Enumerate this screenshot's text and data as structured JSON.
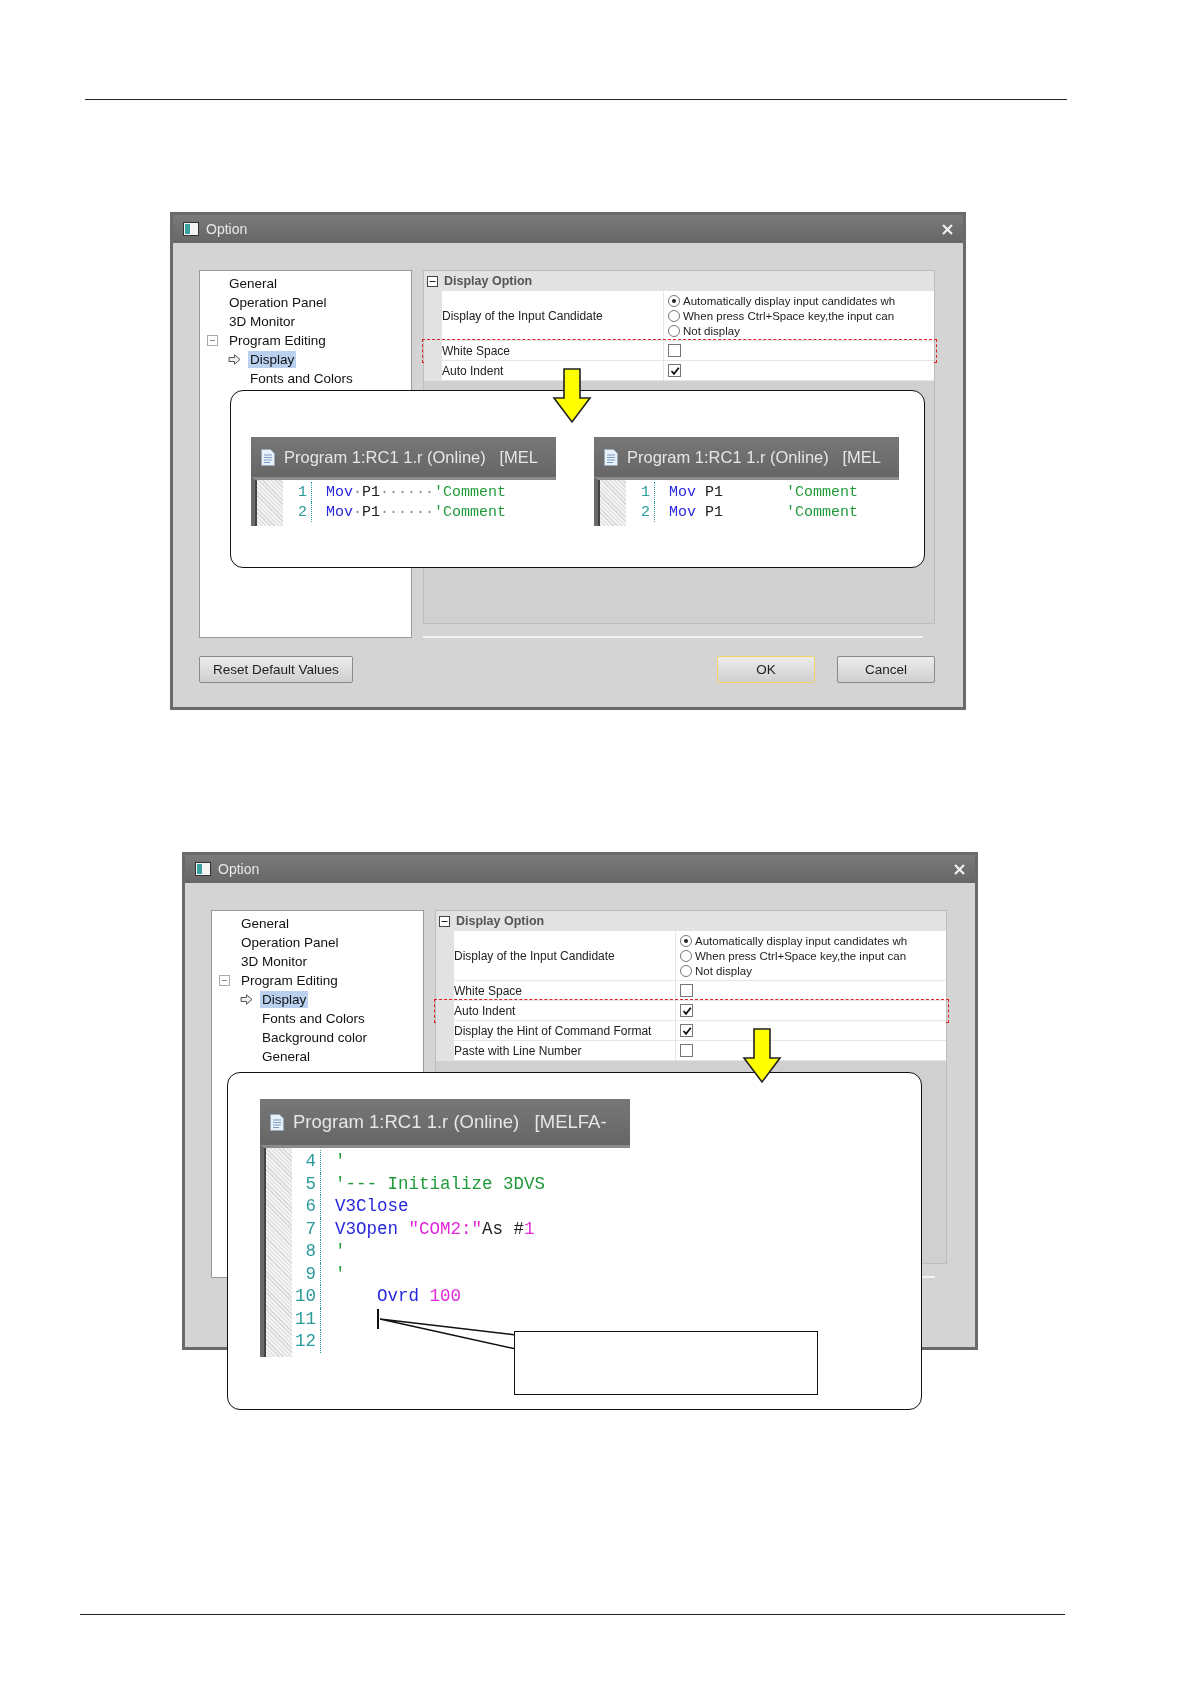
{
  "figures": [
    {
      "dialog": {
        "title": "Option",
        "tree": [
          {
            "label": "General",
            "selected": false
          },
          {
            "label": "Operation Panel",
            "selected": false
          },
          {
            "label": "3D Monitor",
            "selected": false
          },
          {
            "label": "Program Editing",
            "selected": false,
            "expanded": true,
            "children": [
              {
                "label": "Display",
                "selected": true
              },
              {
                "label": "Fonts and Colors",
                "selected": false
              }
            ]
          }
        ],
        "options": {
          "section": "Display Option",
          "expanded": true,
          "rows": [
            {
              "label": "Display of the Input Candidate",
              "kind": "radio",
              "highlighted": false,
              "options": [
                {
                  "label": "Automatically display input candidates wh",
                  "selected": true
                },
                {
                  "label": "When press Ctrl+Space key,the input can",
                  "selected": false
                },
                {
                  "label": "Not display",
                  "selected": false
                }
              ]
            },
            {
              "label": "White Space",
              "kind": "checkbox",
              "checked": false,
              "highlighted": true
            },
            {
              "label": "Auto Indent",
              "kind": "checkbox",
              "checked": true,
              "highlighted": false
            }
          ]
        },
        "buttons": [
          {
            "label": "Reset Default Values",
            "default": false
          },
          {
            "label": "OK",
            "default": true
          },
          {
            "label": "Cancel",
            "default": false
          }
        ]
      },
      "callout": {
        "editors": [
          {
            "title": "Program 1:RC1 1.r (Online)   [MEL",
            "lines": [
              {
                "number": "1",
                "tokens": [
                  {
                    "kind": "keyword",
                    "text": "Mov"
                  },
                  {
                    "kind": "space_mark",
                    "text": "·"
                  },
                  {
                    "kind": "plain",
                    "text": "P1"
                  },
                  {
                    "kind": "space_mark",
                    "text": "······"
                  },
                  {
                    "kind": "comment",
                    "text": "'Comment"
                  }
                ]
              },
              {
                "number": "2",
                "tokens": [
                  {
                    "kind": "keyword",
                    "text": "Mov"
                  },
                  {
                    "kind": "space_mark",
                    "text": "·"
                  },
                  {
                    "kind": "plain",
                    "text": "P1"
                  },
                  {
                    "kind": "space_mark",
                    "text": "······"
                  },
                  {
                    "kind": "comment",
                    "text": "'Comment"
                  }
                ]
              }
            ]
          },
          {
            "title": "Program 1:RC1 1.r (Online)   [MEL",
            "lines": [
              {
                "number": "1",
                "tokens": [
                  {
                    "kind": "keyword",
                    "text": "Mov"
                  },
                  {
                    "kind": "plain",
                    "text": " P1       "
                  },
                  {
                    "kind": "comment",
                    "text": "'Comment"
                  }
                ]
              },
              {
                "number": "2",
                "tokens": [
                  {
                    "kind": "keyword",
                    "text": "Mov"
                  },
                  {
                    "kind": "plain",
                    "text": " P1       "
                  },
                  {
                    "kind": "comment",
                    "text": "'Comment"
                  }
                ]
              }
            ]
          }
        ]
      }
    },
    {
      "dialog": {
        "title": "Option",
        "tree": [
          {
            "label": "General",
            "selected": false
          },
          {
            "label": "Operation Panel",
            "selected": false
          },
          {
            "label": "3D Monitor",
            "selected": false
          },
          {
            "label": "Program Editing",
            "selected": false,
            "expanded": true,
            "children": [
              {
                "label": "Display",
                "selected": true
              },
              {
                "label": "Fonts and Colors",
                "selected": false
              },
              {
                "label": "Background color",
                "selected": false
              },
              {
                "label": "General",
                "selected": false
              }
            ]
          }
        ],
        "options": {
          "section": "Display Option",
          "expanded": true,
          "rows": [
            {
              "label": "Display of the Input Candidate",
              "kind": "radio",
              "highlighted": false,
              "options": [
                {
                  "label": "Automatically display input candidates wh",
                  "selected": true
                },
                {
                  "label": "When press Ctrl+Space key,the input can",
                  "selected": false
                },
                {
                  "label": "Not display",
                  "selected": false
                }
              ]
            },
            {
              "label": "White Space",
              "kind": "checkbox",
              "checked": false,
              "highlighted": false
            },
            {
              "label": "Auto Indent",
              "kind": "checkbox",
              "checked": true,
              "highlighted": true
            },
            {
              "label": "Display the Hint of Command Format",
              "kind": "checkbox",
              "checked": true,
              "highlighted": false
            },
            {
              "label": "Paste with Line Number",
              "kind": "checkbox",
              "checked": false,
              "highlighted": false
            }
          ]
        }
      },
      "callout": {
        "note_box": true,
        "editors": [
          {
            "title": "Program 1:RC1 1.r (Online)   [MELFA-",
            "lines": [
              {
                "number": "4",
                "tokens": [
                  {
                    "kind": "comment",
                    "text": "'"
                  }
                ]
              },
              {
                "number": "5",
                "tokens": [
                  {
                    "kind": "comment",
                    "text": "'--- Initialize 3DVS"
                  }
                ]
              },
              {
                "number": "6",
                "tokens": [
                  {
                    "kind": "keyword",
                    "text": "V3Close"
                  }
                ]
              },
              {
                "number": "7",
                "tokens": [
                  {
                    "kind": "keyword",
                    "text": "V3Open"
                  },
                  {
                    "kind": "string",
                    "text": " \"COM2:\""
                  },
                  {
                    "kind": "plain",
                    "text": "As #"
                  },
                  {
                    "kind": "number",
                    "text": "1"
                  }
                ]
              },
              {
                "number": "8",
                "tokens": [
                  {
                    "kind": "comment",
                    "text": "'"
                  }
                ]
              },
              {
                "number": "9",
                "tokens": [
                  {
                    "kind": "comment",
                    "text": "'"
                  }
                ]
              },
              {
                "number": "10",
                "tokens": [
                  {
                    "kind": "keyword",
                    "text": "    Ovrd"
                  },
                  {
                    "kind": "number",
                    "text": " 100"
                  }
                ]
              },
              {
                "number": "11",
                "cursor": true
              },
              {
                "number": "12"
              }
            ]
          }
        ]
      }
    }
  ]
}
